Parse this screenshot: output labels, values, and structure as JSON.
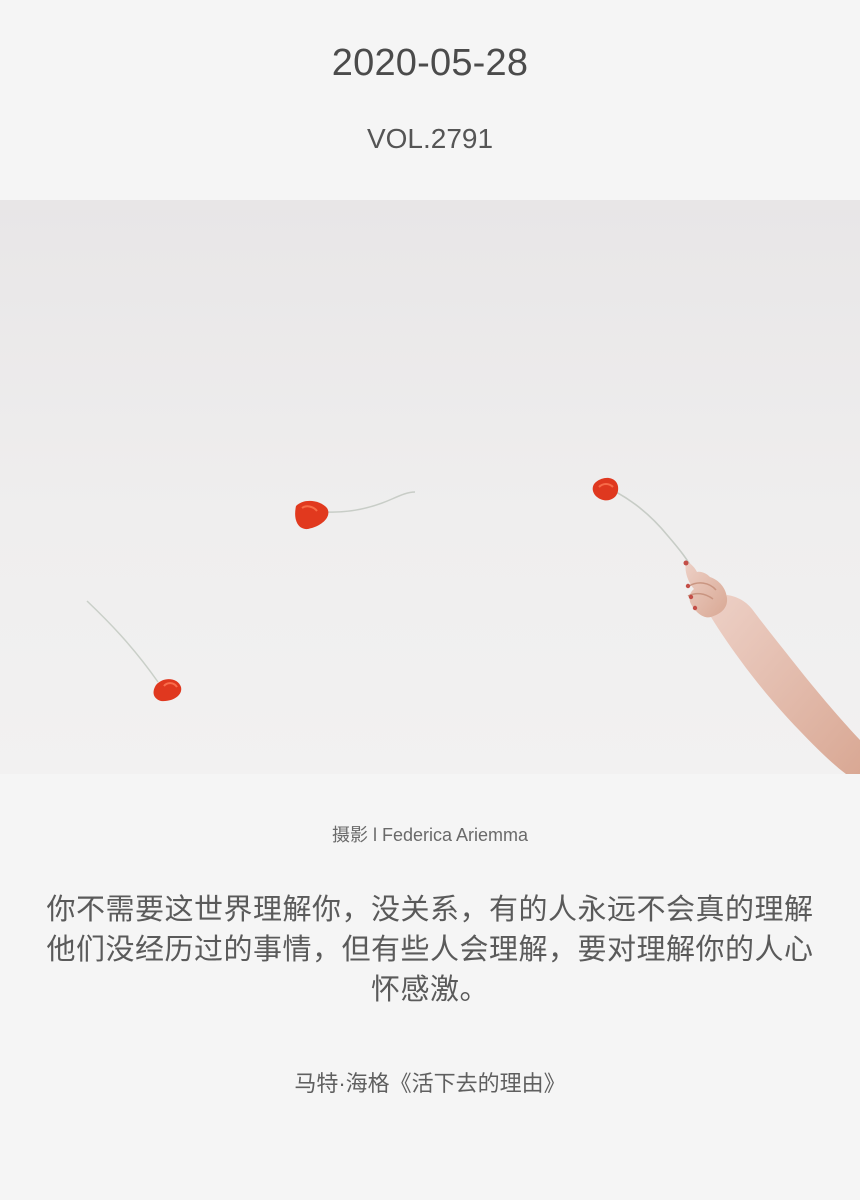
{
  "header": {
    "date": "2020-05-28",
    "volume": "VOL.2791"
  },
  "photo": {
    "icon": "poppy-sky-photo",
    "accent_colors": [
      "#e0391f",
      "#d9d9d9",
      "#e6bca7"
    ]
  },
  "credit": {
    "text": "摄影 l Federica Ariemma"
  },
  "quote": {
    "text": "你不需要这世界理解你，没关系，有的人永远不会真的理解他们没经历过的事情，但有些人会理解，要对理解你的人心怀感激。"
  },
  "source": {
    "text": "马特·海格《活下去的理由》"
  }
}
